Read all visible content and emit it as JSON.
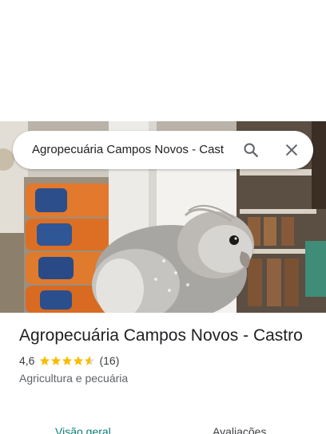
{
  "search": {
    "query": "Agropecuária Campos Novos - Cast"
  },
  "place": {
    "title": "Agropecuária Campos Novos - Castro",
    "rating": "4,6",
    "stars": 4.6,
    "reviews_count": "(16)",
    "category": "Agricultura e pecuária"
  },
  "tabs": [
    {
      "label": "Visão geral",
      "selected": true
    },
    {
      "label": "Avaliações",
      "selected": false
    }
  ],
  "icons": {
    "search": "search-icon",
    "close": "close-icon",
    "star": "star-icon"
  },
  "colors": {
    "star": "#fbbc04",
    "selected_tab": "#0b7d77",
    "text": "#202124",
    "secondary_text": "#5f6368"
  }
}
